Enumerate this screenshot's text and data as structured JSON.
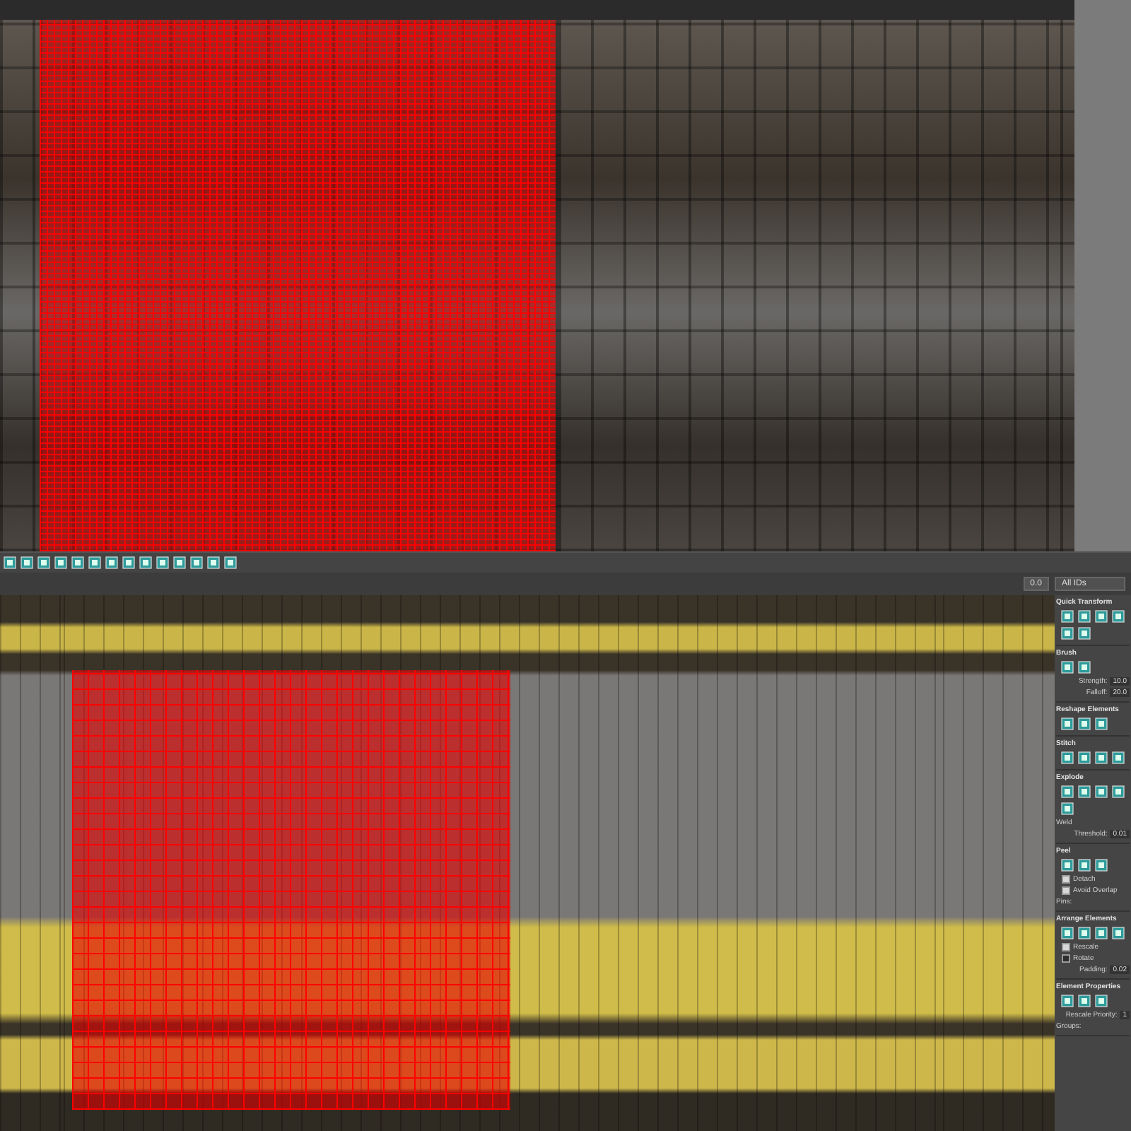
{
  "bottom_editor": {
    "spinner": {
      "value": "0.0"
    },
    "id_dropdown": {
      "value": "All IDs"
    },
    "rollouts": [
      {
        "title": "Quick Transform"
      },
      {
        "title": "Brush",
        "items": [
          {
            "kind": "field",
            "label": "Strength:",
            "value": "10.0"
          },
          {
            "kind": "field",
            "label": "Falloff:",
            "value": "20.0"
          }
        ]
      },
      {
        "title": "Reshape Elements"
      },
      {
        "title": "Stitch"
      },
      {
        "title": "Explode",
        "items": [
          {
            "kind": "label",
            "text": "Weld"
          },
          {
            "kind": "field",
            "label": "Threshold:",
            "value": "0.01"
          }
        ]
      },
      {
        "title": "Peel",
        "items": [
          {
            "kind": "check",
            "label": "Detach",
            "checked": true
          },
          {
            "kind": "check",
            "label": "Avoid Overlap",
            "checked": true
          },
          {
            "kind": "label",
            "text": "Pins:"
          }
        ]
      },
      {
        "title": "Arrange Elements",
        "items": [
          {
            "kind": "check",
            "label": "Rescale",
            "checked": true
          },
          {
            "kind": "check",
            "label": "Rotate",
            "checked": false
          },
          {
            "kind": "field",
            "label": "Padding:",
            "value": "0.02"
          }
        ]
      },
      {
        "title": "Element Properties",
        "items": [
          {
            "kind": "field",
            "label": "Rescale Priority:",
            "value": "1"
          },
          {
            "kind": "label",
            "text": "Groups:"
          }
        ]
      }
    ]
  }
}
